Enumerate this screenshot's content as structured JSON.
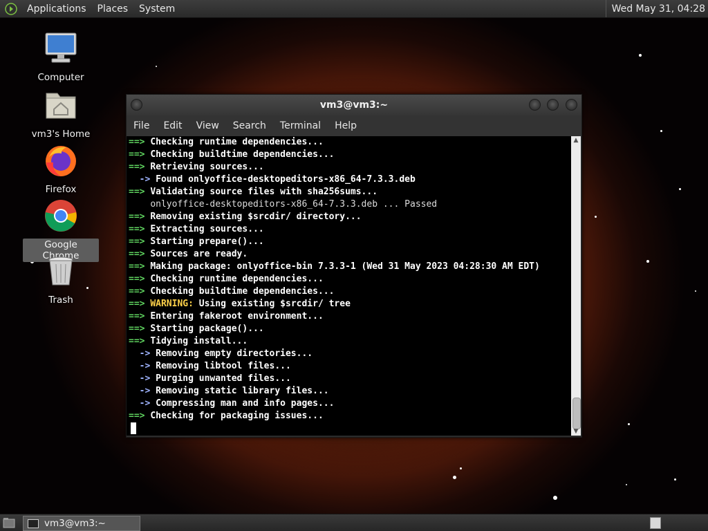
{
  "top_panel": {
    "menus": [
      "Applications",
      "Places",
      "System"
    ],
    "clock": "Wed May 31, 04:28"
  },
  "desktop_icons": [
    {
      "label": "Computer",
      "icon": "computer-icon"
    },
    {
      "label": "vm3's Home",
      "icon": "home-folder-icon"
    },
    {
      "label": "Firefox",
      "icon": "firefox-icon"
    },
    {
      "label": "Google Chrome",
      "icon": "chrome-icon"
    },
    {
      "label": "Trash",
      "icon": "trash-icon"
    }
  ],
  "terminal": {
    "title": "vm3@vm3:~",
    "menu": [
      "File",
      "Edit",
      "View",
      "Search",
      "Terminal",
      "Help"
    ],
    "lines": [
      {
        "prefix": "==> ",
        "text": "Checking runtime dependencies..."
      },
      {
        "prefix": "==> ",
        "text": "Checking buildtime dependencies..."
      },
      {
        "prefix": "==> ",
        "text": "Retrieving sources..."
      },
      {
        "prefix": "  -> ",
        "text": "Found onlyoffice-desktopeditors-x86_64-7.3.3.deb"
      },
      {
        "prefix": "==> ",
        "text": "Validating source files with sha256sums..."
      },
      {
        "prefix": "    ",
        "text": "onlyoffice-desktopeditors-x86_64-7.3.3.deb ... Passed"
      },
      {
        "prefix": "==> ",
        "text": "Removing existing $srcdir/ directory..."
      },
      {
        "prefix": "==> ",
        "text": "Extracting sources..."
      },
      {
        "prefix": "==> ",
        "text": "Starting prepare()..."
      },
      {
        "prefix": "==> ",
        "text": "Sources are ready."
      },
      {
        "prefix": "==> ",
        "text": "Making package: onlyoffice-bin 7.3.3-1 (Wed 31 May 2023 04:28:30 AM EDT)"
      },
      {
        "prefix": "==> ",
        "text": "Checking runtime dependencies..."
      },
      {
        "prefix": "==> ",
        "text": "Checking buildtime dependencies..."
      },
      {
        "prefix": "==> ",
        "warning": "WARNING:",
        "text": " Using existing $srcdir/ tree"
      },
      {
        "prefix": "==> ",
        "text": "Entering fakeroot environment..."
      },
      {
        "prefix": "==> ",
        "text": "Starting package()..."
      },
      {
        "prefix": "==> ",
        "text": "Tidying install..."
      },
      {
        "prefix": "  -> ",
        "text": "Removing empty directories..."
      },
      {
        "prefix": "  -> ",
        "text": "Removing libtool files..."
      },
      {
        "prefix": "  -> ",
        "text": "Purging unwanted files..."
      },
      {
        "prefix": "  -> ",
        "text": "Removing static library files..."
      },
      {
        "prefix": "  -> ",
        "text": "Compressing man and info pages..."
      },
      {
        "prefix": "==> ",
        "text": "Checking for packaging issues..."
      }
    ]
  },
  "taskbar": {
    "task_label": "vm3@vm3:~"
  },
  "colors": {
    "arrow": "#5fd35f",
    "warning": "#ffd24a",
    "terminal_bg": "#000000"
  }
}
